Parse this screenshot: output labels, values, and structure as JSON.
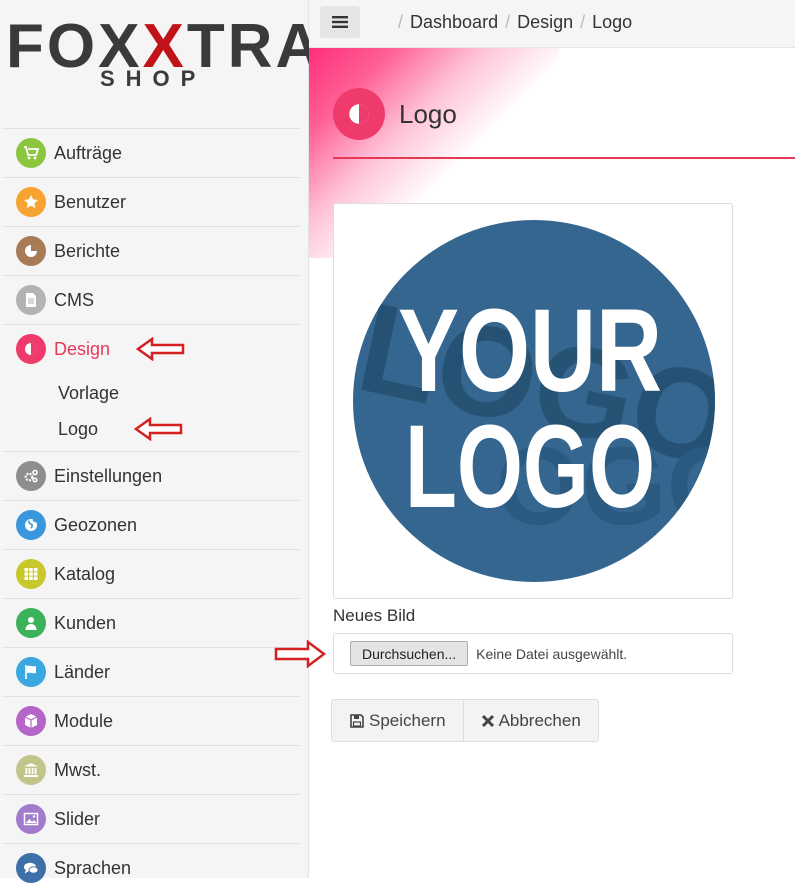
{
  "brand": {
    "name_left": "FOX",
    "name_x": "X",
    "name_right": "TRA",
    "sub": "SHOP"
  },
  "sidebar": {
    "items": [
      {
        "label": "Aufträge",
        "icon": "cart-icon",
        "color": "#8cc63f"
      },
      {
        "label": "Benutzer",
        "icon": "star-icon",
        "color": "#f7a331"
      },
      {
        "label": "Berichte",
        "icon": "pie-chart-icon",
        "color": "#a67b55"
      },
      {
        "label": "CMS",
        "icon": "document-icon",
        "color": "#b3b3b3"
      },
      {
        "label": "Design",
        "icon": "contrast-icon",
        "color": "#ef3a6c"
      },
      {
        "label": "Einstellungen",
        "icon": "cogs-icon",
        "color": "#8e8e8e"
      },
      {
        "label": "Geozonen",
        "icon": "globe-icon",
        "color": "#3a97de"
      },
      {
        "label": "Katalog",
        "icon": "grid-icon",
        "color": "#c8c82d"
      },
      {
        "label": "Kunden",
        "icon": "user-icon",
        "color": "#3cb35b"
      },
      {
        "label": "Länder",
        "icon": "flag-icon",
        "color": "#3aa7df"
      },
      {
        "label": "Module",
        "icon": "cube-icon",
        "color": "#b564c8"
      },
      {
        "label": "Mwst.",
        "icon": "bank-icon",
        "color": "#c3c48a"
      },
      {
        "label": "Slider",
        "icon": "image-icon",
        "color": "#a27ccc"
      },
      {
        "label": "Sprachen",
        "icon": "comments-icon",
        "color": "#3d6fa8"
      }
    ],
    "design_sub": [
      "Vorlage",
      "Logo"
    ]
  },
  "topbar": {
    "crumbs": [
      "Dashboard",
      "Design",
      "Logo"
    ]
  },
  "page": {
    "title": "Logo",
    "logo_line1": "YOUR",
    "logo_line2": "LOGO",
    "new_image_label": "Neues Bild",
    "file_button": "Durchsuchen...",
    "file_status": "Keine Datei ausgewählt.",
    "save": "Speichern",
    "cancel": "Abbrechen"
  },
  "colors": {
    "accent": "#e53958",
    "annotation_arrow": "#d42020",
    "logo_circle": "#34668f"
  }
}
